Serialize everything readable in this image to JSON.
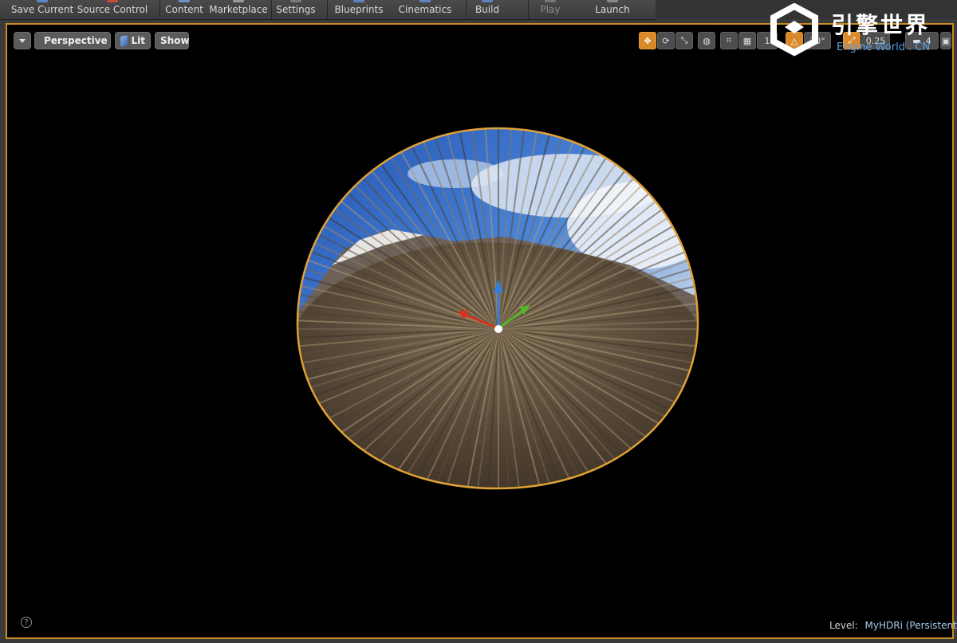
{
  "toolbar": {
    "buttons": [
      {
        "label": "Save Current",
        "icon": "save-icon"
      },
      {
        "label": "Source Control",
        "icon": "source-control-icon"
      },
      {
        "label": "Content",
        "icon": "content-icon"
      },
      {
        "label": "Marketplace",
        "icon": "marketplace-icon"
      },
      {
        "label": "Settings",
        "icon": "settings-icon"
      },
      {
        "label": "Blueprints",
        "icon": "blueprints-icon"
      },
      {
        "label": "Cinematics",
        "icon": "cinematics-icon"
      },
      {
        "label": "Build",
        "icon": "build-icon"
      },
      {
        "label": "Play",
        "icon": "play-icon"
      },
      {
        "label": "Launch",
        "icon": "launch-icon"
      }
    ]
  },
  "viewport": {
    "view_mode_label": "Perspective",
    "lighting_label": "Lit",
    "show_label": "Show",
    "tools": {
      "translate_icon": "translate-icon",
      "rotate_icon": "rotate-icon",
      "scale_icon": "scale-icon",
      "world_local_icon": "globe-icon",
      "surface_snap_icon": "surface-snap-icon",
      "grid_snap_icon": "grid-snap-icon",
      "grid_value": "1",
      "rotation_snap_icon": "rotation-snap-icon",
      "rotation_value": "10°",
      "scale_snap_icon": "scale-snap-icon",
      "scale_value": "0.25",
      "camera_speed_icon": "camera-speed-icon",
      "camera_speed_value": "4",
      "maximize_icon": "maximize-icon"
    },
    "level_label": "Level:",
    "level_value": "MyHDRi (Persistent)"
  },
  "watermark": {
    "title": "引擎世界",
    "subtitle": "Engine World . CN"
  },
  "colors": {
    "selection_outline": "#e0a135",
    "axis_x": "#d8321e",
    "axis_y": "#56b428",
    "axis_z": "#2f7fe0",
    "active_tool": "#d8892a"
  }
}
